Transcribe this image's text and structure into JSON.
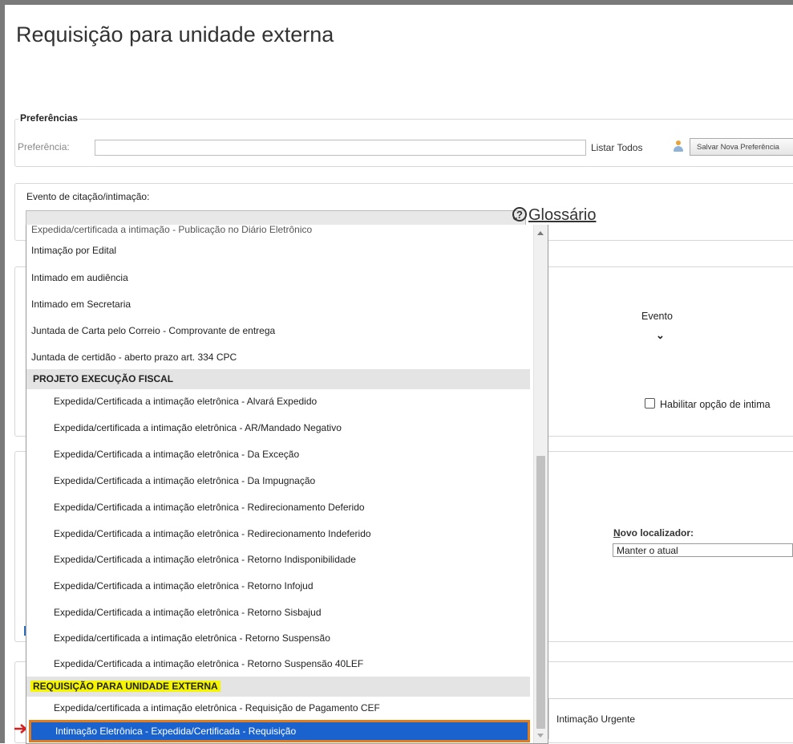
{
  "page": {
    "title": "Requisição para unidade externa"
  },
  "preferencias": {
    "legend": "Preferências",
    "label": "Preferência:",
    "value": "",
    "listar_todos": "Listar Todos",
    "salvar_label": "Salvar Nova Preferência"
  },
  "evento": {
    "label": "Evento de citação/intimação:",
    "selected": "",
    "glossario": "Glossário"
  },
  "table": {
    "evento_header": "Evento"
  },
  "checkbox": {
    "label": "Habilitar opção de intima"
  },
  "localizador": {
    "label": "Novo localizador:",
    "value": "Manter o atual"
  },
  "urgente": {
    "label": "Intimação Urgente"
  },
  "dropdown": {
    "clipped_item": "Expedida/certificada a intimação - Publicação no Diário Eletrônico",
    "items_top": [
      "Intimação por Edital",
      "Intimado em audiência",
      "Intimado em Secretaria",
      "Juntada de Carta pelo Correio - Comprovante de entrega",
      "Juntada de certidão - aberto prazo art. 334 CPC"
    ],
    "group1": "PROJETO EXECUÇÃO FISCAL",
    "group1_items": [
      "Expedida/Certificada a intimação eletrônica - Alvará Expedido",
      "Expedida/certificada a intimação eletrônica - AR/Mandado Negativo",
      "Expedida/Certificada a intimação eletrônica - Da Exceção",
      "Expedida/Certificada a intimação eletrônica - Da Impugnação",
      "Expedida/Certificada a intimação eletrônica - Redirecionamento Deferido",
      "Expedida/Certificada a intimação eletrônica - Redirecionamento Indeferido",
      "Expedida/Certificada a intimação eletrônica - Retorno Indisponibilidade",
      "Expedida/Certificada a intimação eletrônica - Retorno Infojud",
      "Expedida/Certificada a intimação eletrônica - Retorno Sisbajud",
      "Expedida/certificada a intimação eletrônica - Retorno Suspensão",
      "Expedida/Certificada a intimação eletrônica - Retorno Suspensão 40LEF"
    ],
    "group2": "REQUISIÇÃO PARA UNIDADE EXTERNA",
    "group2_items": [
      "Expedida/certificada a intimação eletrônica - Requisição de Pagamento CEF"
    ],
    "selected_item": "Intimação Eletrônica - Expedida/Certificada - Requisição",
    "colors": {
      "selected_bg": "#1a63cf",
      "selected_border": "#e07b1e",
      "group_highlight": "#f5f500"
    }
  }
}
